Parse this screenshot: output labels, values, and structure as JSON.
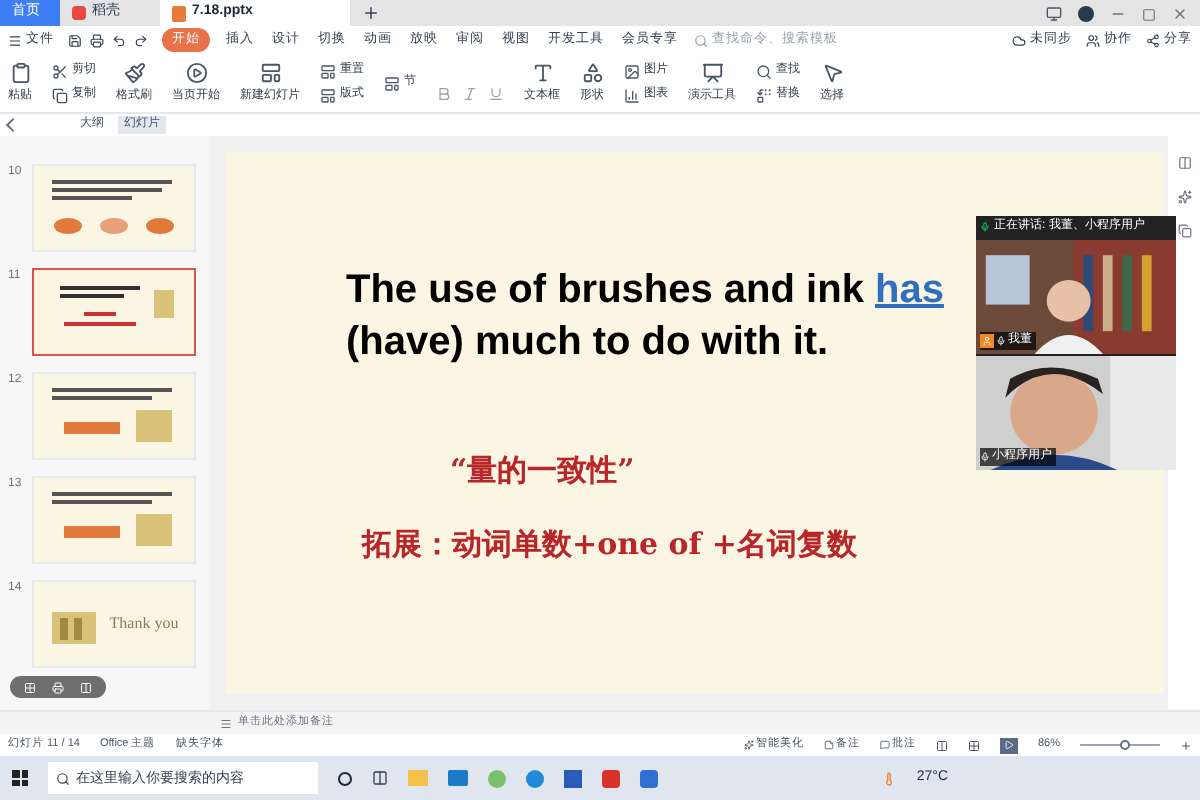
{
  "tabs": [
    {
      "label": "首页",
      "selected": false,
      "kind": "home"
    },
    {
      "label": "稻壳",
      "selected": false,
      "kind": "docer"
    },
    {
      "label": "7.18.pptx",
      "selected": true,
      "kind": "file"
    }
  ],
  "menu": {
    "file": "文件",
    "items": [
      {
        "label": "开始",
        "selected": true
      },
      {
        "label": "插入",
        "selected": false
      },
      {
        "label": "设计",
        "selected": false
      },
      {
        "label": "切换",
        "selected": false
      },
      {
        "label": "动画",
        "selected": false
      },
      {
        "label": "放映",
        "selected": false
      },
      {
        "label": "审阅",
        "selected": false
      },
      {
        "label": "视图",
        "selected": false
      },
      {
        "label": "开发工具",
        "selected": false
      },
      {
        "label": "会员专享",
        "selected": false
      }
    ],
    "search": {
      "placeholder": "查找命令、搜索模板"
    },
    "actions": [
      "未同步",
      "协作",
      "分享"
    ]
  },
  "ribbon": [
    {
      "kind": "large",
      "label": "粘贴"
    },
    {
      "kind": "pair",
      "labels": [
        "剪切",
        "复制"
      ]
    },
    {
      "kind": "large",
      "label": "格式刷"
    },
    {
      "kind": "large",
      "label": "当页开始"
    },
    {
      "kind": "large",
      "label": "新建幻灯片"
    },
    {
      "kind": "pair",
      "labels": [
        "重置",
        "版式"
      ]
    },
    {
      "kind": "pair",
      "labels": [
        "节"
      ]
    },
    {
      "kind": "format"
    },
    {
      "kind": "large",
      "label": "文本框"
    },
    {
      "kind": "large",
      "label": "形状"
    },
    {
      "kind": "pair",
      "labels": [
        "图片",
        "图表"
      ]
    },
    {
      "kind": "large",
      "label": "演示工具"
    },
    {
      "kind": "pair",
      "labels": [
        "查找",
        "替换"
      ]
    },
    {
      "kind": "large",
      "label": "选择"
    }
  ],
  "panel_tabs": [
    {
      "label": "大纲",
      "selected": false
    },
    {
      "label": "幻灯片",
      "selected": true
    }
  ],
  "slides": [
    {
      "number": "10",
      "selected": false,
      "kind": "circles"
    },
    {
      "number": "11",
      "selected": true,
      "kind": "title"
    },
    {
      "number": "12",
      "selected": false,
      "kind": "bar"
    },
    {
      "number": "13",
      "selected": false,
      "kind": "bar"
    },
    {
      "number": "14",
      "selected": false,
      "kind": "thanks",
      "text": "Thank you"
    }
  ],
  "slide": {
    "lines": [
      [
        {
          "text": "The use of brushes and ink ",
          "kind": "plain"
        },
        {
          "text": "has",
          "kind": "link"
        }
      ],
      [
        {
          "text": "(have) much to do with it.",
          "kind": "plain"
        }
      ]
    ],
    "subtitle": "“量的一致性”",
    "extension": "拓展：动词单数+one of +名词复数"
  },
  "video": {
    "header": "正在讲话: 我董、小程序用户",
    "tiles": [
      {
        "name": "我董",
        "host": true,
        "kind": "room"
      },
      {
        "name": "小程序用户",
        "host": false,
        "kind": "closeup"
      }
    ]
  },
  "notes_placeholder": "单击此处添加备注",
  "status": {
    "slide": "幻灯片 11 / 14",
    "theme": "Office 主题",
    "font": "缺失字体",
    "smart": "智能美化",
    "notes": "备注",
    "comment": "批注",
    "zoom": "86%",
    "level": 0.55
  },
  "taskbar": {
    "search": {
      "placeholder": "在这里输入你要搜索的内容"
    },
    "temp": "27°C"
  }
}
